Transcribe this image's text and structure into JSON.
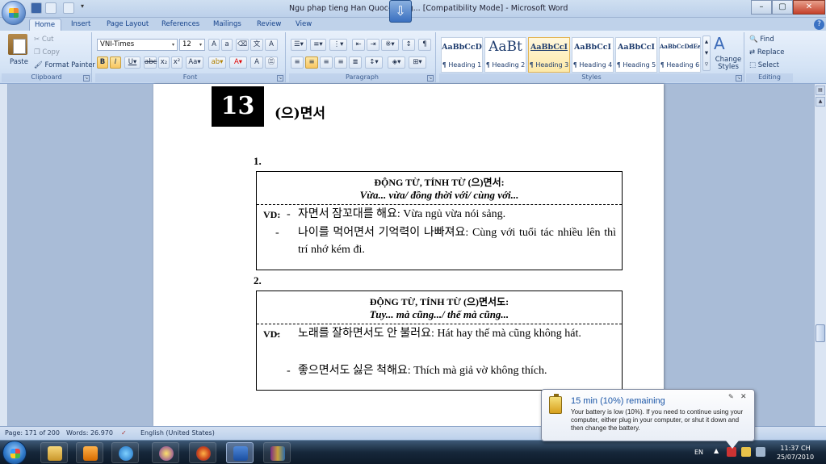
{
  "titlebar": {
    "title": "Ngu phap tieng Han Quoc- tieng... [Compatibility Mode] - Microsoft Word",
    "minimize": "–",
    "maximize": "▢",
    "close": "✕"
  },
  "tabs": [
    "Home",
    "Insert",
    "Page Layout",
    "References",
    "Mailings",
    "Review",
    "View"
  ],
  "ribbon": {
    "clipboard": {
      "title": "Clipboard",
      "paste": "Paste",
      "cut": "Cut",
      "copy": "Copy",
      "format_painter": "Format Painter"
    },
    "font": {
      "title": "Font",
      "font_name": "VNI-Times",
      "font_size": "12"
    },
    "paragraph": {
      "title": "Paragraph"
    },
    "styles": {
      "title": "Styles",
      "items": [
        {
          "preview": "AaBbCcD",
          "name": "¶ Heading 1"
        },
        {
          "preview": "AaBt",
          "name": "¶ Heading 2"
        },
        {
          "preview": "AaBbCcI",
          "name": "¶ Heading 3"
        },
        {
          "preview": "AaBbCcI",
          "name": "¶ Heading 4"
        },
        {
          "preview": "AaBbCcI",
          "name": "¶ Heading 5"
        },
        {
          "preview": "AaBbCcDdEe",
          "name": "¶ Heading 6"
        }
      ],
      "change_styles": "Change Styles"
    },
    "editing": {
      "title": "Editing",
      "find": "Find",
      "replace": "Replace",
      "select": "Select"
    }
  },
  "document": {
    "chapter_number": "13",
    "chapter_title": "(으)면서",
    "sections": [
      {
        "number": "1.",
        "head1": "ĐỘNG TỪ, TÍNH TỪ (으)면서:",
        "head2": "Vừa... vừa/ đồng thời với/ cùng với...",
        "vd": "VD:",
        "examples": [
          "자면서 잠꼬대를 해요: Vừa ngủ vừa nói sảng.",
          "나이를 먹어면서 기억력이 나빠져요: Cùng với tuổi tác nhiều lên thì trí nhớ kém đi."
        ]
      },
      {
        "number": "2.",
        "head1": "ĐỘNG TỪ, TÍNH TỪ (으)면서도:",
        "head2": "Tuy... mà cũng.../ thế mà cũng...",
        "vd": "VD:",
        "examples": [
          "노래를 잘하면서도 안 불러요: Hát hay thế mà cũng không hát.",
          "좋으면서도 싫은 척해요: Thích mà giả vờ không thích."
        ]
      }
    ]
  },
  "statusbar": {
    "page": "Page: 171 of 200",
    "words": "Words: 26.970",
    "language": "English (United States)"
  },
  "notification": {
    "title": "15 min (10%) remaining",
    "text": "Your battery is low (10%). If you need to continue using your computer, either plug in your computer, or shut it down and then change the battery."
  },
  "taskbar": {
    "lang": "EN",
    "time": "11:37 CH",
    "date": "25/07/2010"
  }
}
